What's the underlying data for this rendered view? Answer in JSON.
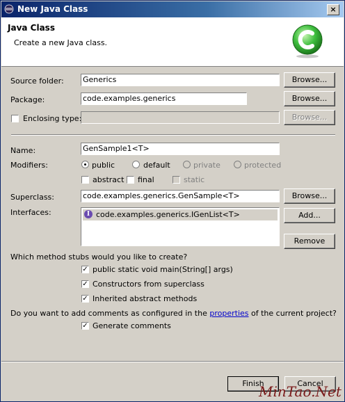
{
  "window": {
    "title": "New Java Class",
    "close_glyph": "×"
  },
  "banner": {
    "title": "Java Class",
    "description": "Create a new Java class."
  },
  "source_folder": {
    "label": "Source folder:",
    "value": "Generics",
    "browse": "Browse..."
  },
  "package": {
    "label": "Package:",
    "value": "code.examples.generics",
    "browse": "Browse..."
  },
  "enclosing_type": {
    "label": "Enclosing type:",
    "checked": false,
    "value": "",
    "browse": "Browse..."
  },
  "name": {
    "label": "Name:",
    "value": "GenSample1<T>"
  },
  "modifiers": {
    "label": "Modifiers:",
    "access": [
      {
        "label": "public",
        "selected": true,
        "enabled": true
      },
      {
        "label": "default",
        "selected": false,
        "enabled": true
      },
      {
        "label": "private",
        "selected": false,
        "enabled": false
      },
      {
        "label": "protected",
        "selected": false,
        "enabled": false
      }
    ],
    "abstract": "abstract",
    "final": "final",
    "static": "static"
  },
  "superclass": {
    "label": "Superclass:",
    "value": "code.examples.generics.GenSample<T>",
    "browse": "Browse..."
  },
  "interfaces": {
    "label": "Interfaces:",
    "items": [
      "code.examples.generics.IGenList<T>"
    ],
    "add": "Add...",
    "remove": "Remove",
    "icon_letter": "I"
  },
  "stubs": {
    "question": "Which method stubs would you like to create?",
    "options": [
      {
        "label": "public static void main(String[] args)",
        "checked": true
      },
      {
        "label": "Constructors from superclass",
        "checked": true
      },
      {
        "label": "Inherited abstract methods",
        "checked": true
      }
    ]
  },
  "comments": {
    "question_prefix": "Do you want to add comments as configured in the",
    "link": "properties",
    "question_suffix": "of the current project?",
    "generate": "Generate comments",
    "generate_checked": true
  },
  "footer": {
    "finish": "Finish",
    "cancel": "Cancel"
  },
  "watermark": "MinTao.Net",
  "colors": {
    "title_bar": "#0a246a",
    "dialog_bg": "#d4d0c8",
    "interface_icon": "#6a4bb0",
    "wizard_icon": "#3fbf3f"
  }
}
